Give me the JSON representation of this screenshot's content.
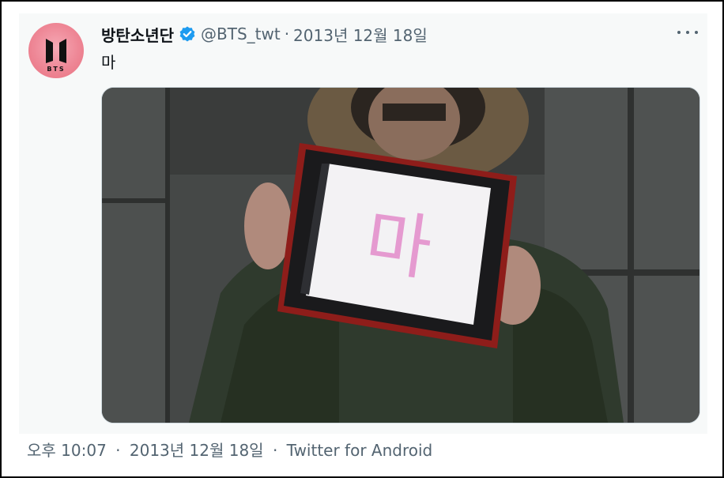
{
  "tweet": {
    "display_name": "방탄소년단",
    "handle": "@BTS_twt",
    "separator": "·",
    "date": "2013년 12월 18일",
    "text": "마",
    "avatar_text": "BTS",
    "media_text": "마",
    "more_icon": "more-horizontal-icon",
    "verified_icon": "verified-badge-icon"
  },
  "footer": {
    "time": "오후 10:07",
    "separator1": "·",
    "date": "2013년 12월 18일",
    "separator2": "·",
    "source": "Twitter for Android"
  },
  "colors": {
    "verified": "#1d9bf0",
    "secondary_text": "#536471",
    "primary_text": "#0f1419",
    "avatar_pink": "#ee8796"
  }
}
